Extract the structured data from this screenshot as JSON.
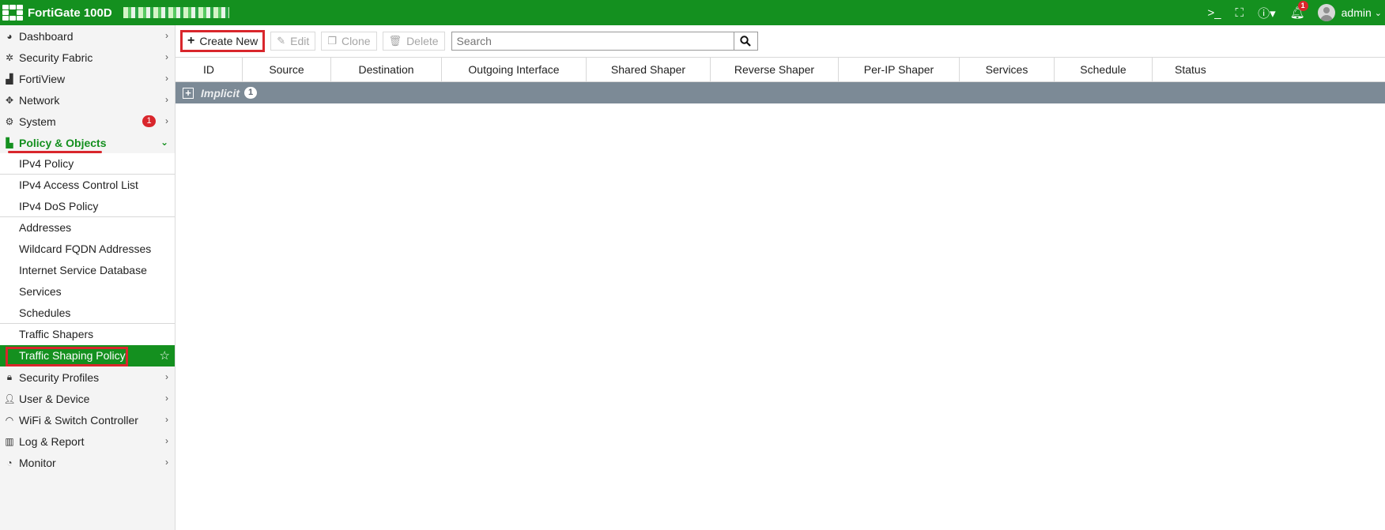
{
  "header": {
    "brand": "FortiGate 100D",
    "user": "admin",
    "notification_count": "1"
  },
  "sidebar": {
    "items": [
      {
        "label": "Dashboard",
        "icon": "dashboard-icon"
      },
      {
        "label": "Security Fabric",
        "icon": "fabric-icon"
      },
      {
        "label": "FortiView",
        "icon": "chart-icon"
      },
      {
        "label": "Network",
        "icon": "network-icon"
      },
      {
        "label": "System",
        "icon": "gear-icon",
        "badge": "1"
      },
      {
        "label": "Policy & Objects",
        "icon": "policy-icon"
      },
      {
        "label": "Security Profiles",
        "icon": "lock-icon"
      },
      {
        "label": "User & Device",
        "icon": "user-icon"
      },
      {
        "label": "WiFi & Switch Controller",
        "icon": "wifi-icon"
      },
      {
        "label": "Log & Report",
        "icon": "log-icon"
      },
      {
        "label": "Monitor",
        "icon": "monitor-icon"
      }
    ],
    "policy_sub": [
      "IPv4 Policy",
      "IPv4 Access Control List",
      "IPv4 DoS Policy",
      "Addresses",
      "Wildcard FQDN Addresses",
      "Internet Service Database",
      "Services",
      "Schedules",
      "Traffic Shapers",
      "Traffic Shaping Policy"
    ]
  },
  "toolbar": {
    "create_new": "Create New",
    "edit": "Edit",
    "clone": "Clone",
    "delete": "Delete",
    "search_placeholder": "Search"
  },
  "table": {
    "columns": [
      "ID",
      "Source",
      "Destination",
      "Outgoing Interface",
      "Shared Shaper",
      "Reverse Shaper",
      "Per-IP Shaper",
      "Services",
      "Schedule",
      "Status"
    ],
    "group": {
      "label": "Implicit",
      "count": "1"
    }
  },
  "colors": {
    "brand_green": "#14901f",
    "highlight_red": "#d9262c",
    "group_row": "#7c8a96"
  }
}
